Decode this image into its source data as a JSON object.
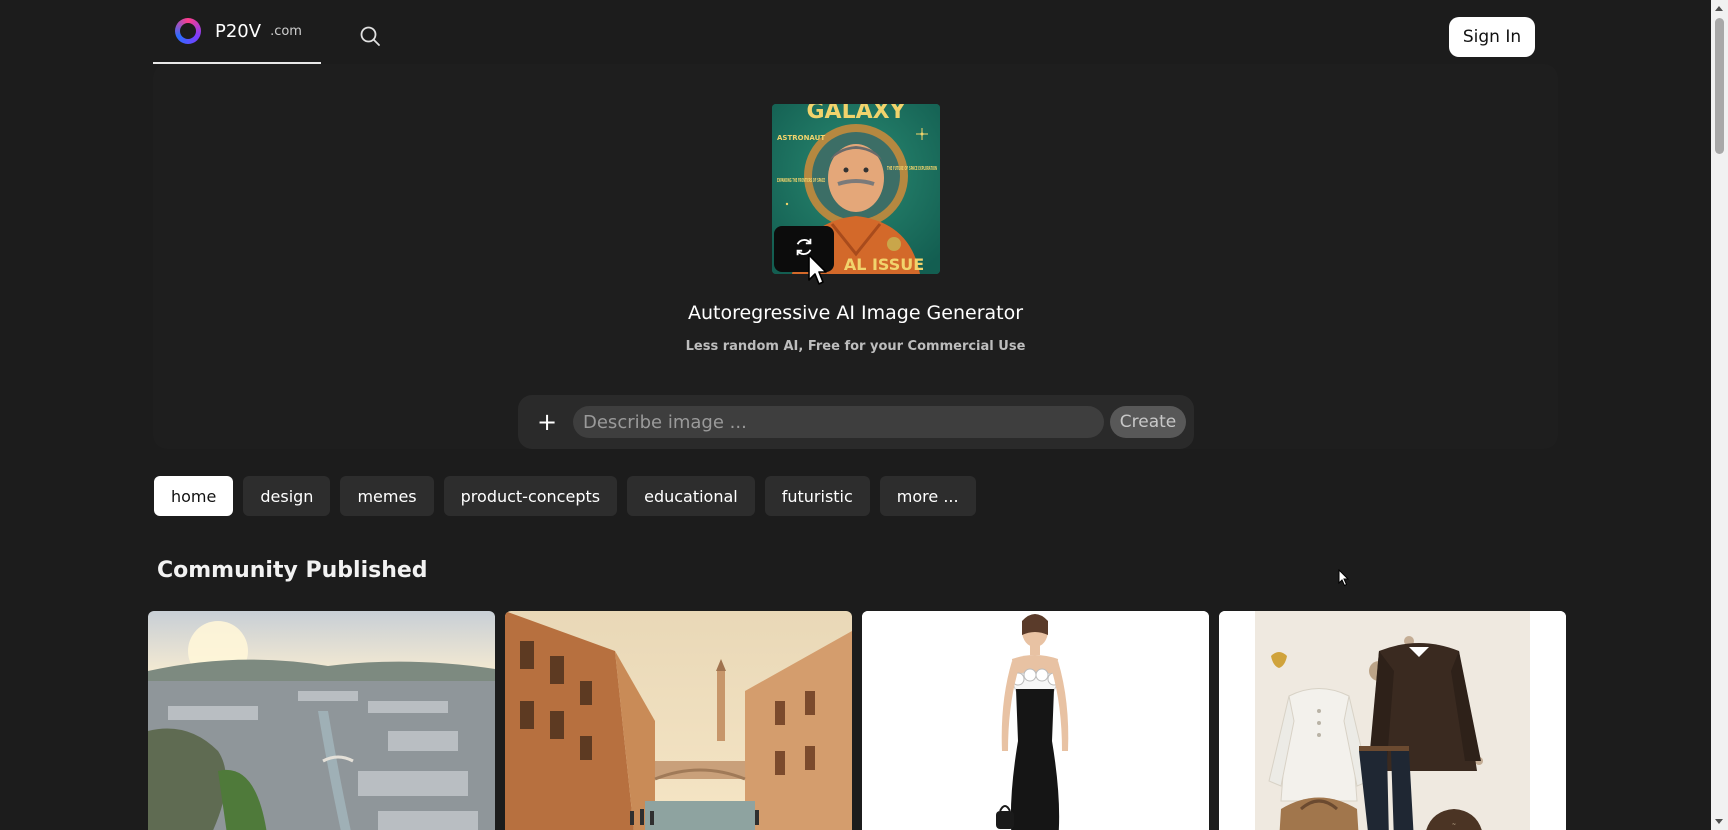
{
  "header": {
    "brand_name": "P20V",
    "brand_tld": ".com",
    "search_icon": "search-icon",
    "signin_label": "Sign In"
  },
  "hero": {
    "image_poster_text": {
      "title": "GALAXY",
      "kicker": "ASTRONAUT",
      "left_caption": "EXPANDING THE FRONTIERS OF SPACE",
      "right_caption": "THE FUTURE OF SPACE EXPLORATION",
      "bottom_text": "AL ISSUE"
    },
    "regenerate_icon": "refresh-icon",
    "title": "Autoregressive AI Image Generator",
    "subtitle": "Less random AI, Free for your Commercial Use"
  },
  "prompt": {
    "add_label": "+",
    "placeholder": "Describe image ...",
    "value": "",
    "create_label": "Create"
  },
  "tags": [
    {
      "label": "home",
      "active": true
    },
    {
      "label": "design",
      "active": false
    },
    {
      "label": "memes",
      "active": false
    },
    {
      "label": "product-concepts",
      "active": false
    },
    {
      "label": "educational",
      "active": false
    },
    {
      "label": "futuristic",
      "active": false
    },
    {
      "label": "more ...",
      "active": false
    }
  ],
  "community": {
    "title": "Community Published",
    "cards": [
      {
        "subject": "aerial-city"
      },
      {
        "subject": "venice-canal"
      },
      {
        "subject": "black-dress-sketch"
      },
      {
        "subject": "fashion-outfit"
      }
    ]
  },
  "colors": {
    "background": "#1c1c1c",
    "tag_bg": "#2d2d2d",
    "active_tag_bg": "#ffffff",
    "accent_pink": "#ff3d8b",
    "accent_blue": "#2b6cff"
  }
}
